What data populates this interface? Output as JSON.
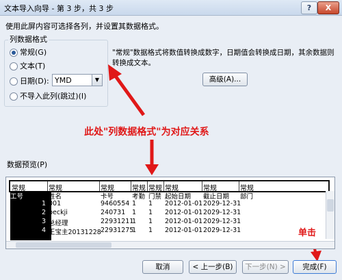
{
  "window": {
    "title": "文本导入向导 - 第 3 步，共 3 步",
    "help": "?",
    "close": "X"
  },
  "instruction": "使用此屏内容可选择各列，并设置其数据格式。",
  "column_format": {
    "group_title": "列数据格式",
    "options": [
      {
        "label": "常规(G)",
        "checked": true
      },
      {
        "label": "文本(T)",
        "checked": false
      },
      {
        "label": "日期(D):",
        "checked": false
      },
      {
        "label": "不导入此列(跳过)(I)",
        "checked": false
      }
    ],
    "date_format": "YMD"
  },
  "description": "\"常规\"数据格式将数值转换成数字，日期值会转换成日期，其余数据则转换成文本。",
  "advanced_button": "高级(A)...",
  "annotation": {
    "text": "此处\"列数据格式\"为对应关系",
    "click": "单击",
    "color": "#e01818"
  },
  "preview": {
    "label": "数据预览(P)",
    "headers": [
      "常规",
      "常规",
      "常规",
      "常规",
      "常规",
      "常规",
      "常规",
      "常规"
    ],
    "rows": [
      [
        "工号",
        "姓名",
        "卡号",
        "考勤",
        "门禁",
        "起始日期",
        "截止日期",
        "部门"
      ],
      [
        "1",
        "001",
        "9460554",
        "1",
        "1",
        "2012-01-01",
        "2029-12-31",
        ""
      ],
      [
        "2",
        "beckji",
        "240731",
        "1",
        "1",
        "2012-01-01",
        "2029-12-31",
        ""
      ],
      [
        "3",
        "总经理",
        "22931211",
        "1",
        "1",
        "2012-01-01",
        "2029-12-31",
        ""
      ],
      [
        "4",
        "王宝主20131228",
        "22931275",
        "1",
        "1",
        "2012-01-01",
        "2029-12-31",
        ""
      ]
    ]
  },
  "buttons": {
    "cancel": "取消",
    "back": "< 上一步(B)",
    "next": "下一步(N) >",
    "finish": "完成(F)"
  }
}
